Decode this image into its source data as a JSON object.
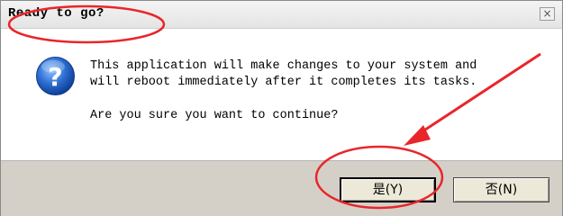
{
  "window": {
    "title": "Ready to go?",
    "close_symbol": "×"
  },
  "message": {
    "line1": "This application will make changes to your system and",
    "line2": "will reboot immediately after it completes its tasks.",
    "question": "Are you sure you want to continue?"
  },
  "icon": {
    "name": "question-icon",
    "glyph": "?",
    "color": "#1f5fbf"
  },
  "buttons": {
    "yes_label": "是(Y)",
    "no_label": "否(N)"
  },
  "annotations": {
    "color": "#e8262a"
  }
}
